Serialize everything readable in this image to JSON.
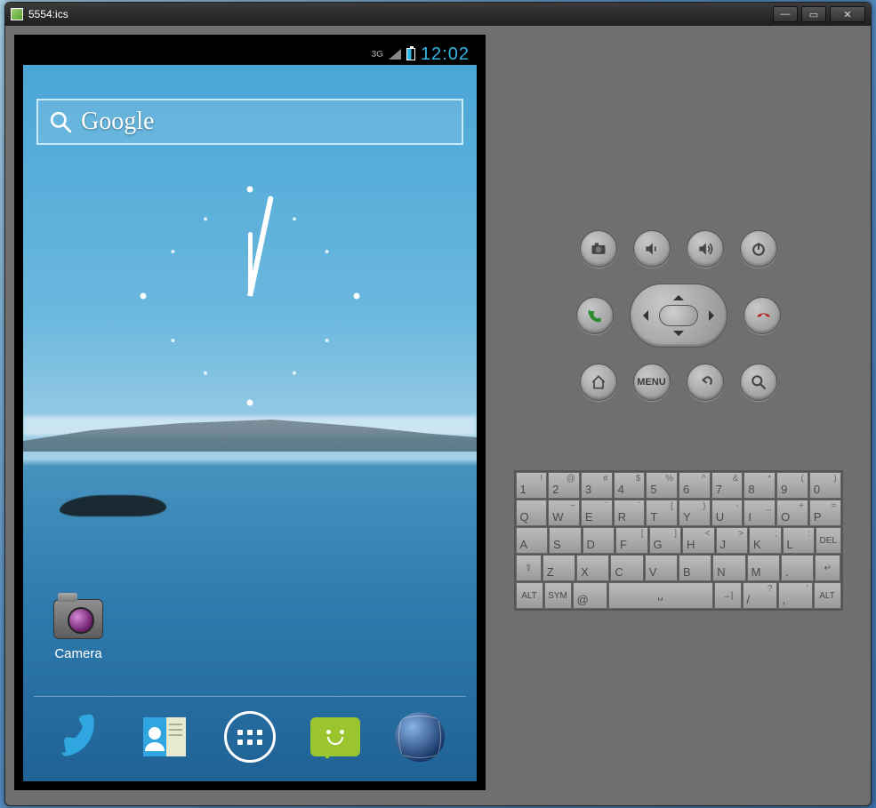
{
  "window": {
    "title": "5554:ics"
  },
  "statusbar": {
    "network": "3G",
    "time": "12:02"
  },
  "search": {
    "placeholder": "Google"
  },
  "shortcuts": [
    {
      "label": "Camera"
    }
  ],
  "dock": {
    "items": [
      "phone",
      "contacts",
      "apps",
      "messaging",
      "browser"
    ]
  },
  "controls": {
    "row1": [
      "camera",
      "volume-down",
      "volume-up",
      "power"
    ],
    "row2": [
      "call",
      "dpad",
      "end-call"
    ],
    "row3": [
      "home",
      "menu",
      "back",
      "search"
    ],
    "menu_label": "MENU"
  },
  "keyboard": {
    "rows": [
      [
        {
          "m": "1",
          "s": "!"
        },
        {
          "m": "2",
          "s": "@"
        },
        {
          "m": "3",
          "s": "#"
        },
        {
          "m": "4",
          "s": "$"
        },
        {
          "m": "5",
          "s": "%"
        },
        {
          "m": "6",
          "s": "^"
        },
        {
          "m": "7",
          "s": "&"
        },
        {
          "m": "8",
          "s": "*"
        },
        {
          "m": "9",
          "s": "("
        },
        {
          "m": "0",
          "s": ")"
        }
      ],
      [
        {
          "m": "Q"
        },
        {
          "m": "W",
          "s": "~"
        },
        {
          "m": "E",
          "s": "´"
        },
        {
          "m": "R",
          "s": "`"
        },
        {
          "m": "T",
          "s": "{"
        },
        {
          "m": "Y",
          "s": "}"
        },
        {
          "m": "U",
          "s": "-"
        },
        {
          "m": "I",
          "s": "_"
        },
        {
          "m": "O",
          "s": "+"
        },
        {
          "m": "P",
          "s": "="
        }
      ],
      [
        {
          "m": "A"
        },
        {
          "m": "S"
        },
        {
          "m": "D"
        },
        {
          "m": "F",
          "s": "["
        },
        {
          "m": "G",
          "s": "]"
        },
        {
          "m": "H",
          "s": "<"
        },
        {
          "m": "J",
          "s": ">"
        },
        {
          "m": "K",
          "s": ";"
        },
        {
          "m": "L",
          "s": ":"
        },
        {
          "m": "DEL",
          "sm": true
        }
      ],
      [
        {
          "m": "⇧",
          "sm": true
        },
        {
          "m": "Z"
        },
        {
          "m": "X"
        },
        {
          "m": "C"
        },
        {
          "m": "V"
        },
        {
          "m": "B"
        },
        {
          "m": "N"
        },
        {
          "m": "M"
        },
        {
          "m": "."
        },
        {
          "m": "↵",
          "sm": true
        }
      ],
      [
        {
          "m": "ALT",
          "sm": true
        },
        {
          "m": "SYM",
          "sm": true
        },
        {
          "m": "@"
        },
        {
          "m": "␣",
          "w": "w40",
          "sm": true
        },
        {
          "m": "→|",
          "sm": true
        },
        {
          "m": "/",
          "s": "?"
        },
        {
          "m": ",",
          "s": "'"
        },
        {
          "m": "ALT",
          "sm": true
        }
      ]
    ]
  }
}
